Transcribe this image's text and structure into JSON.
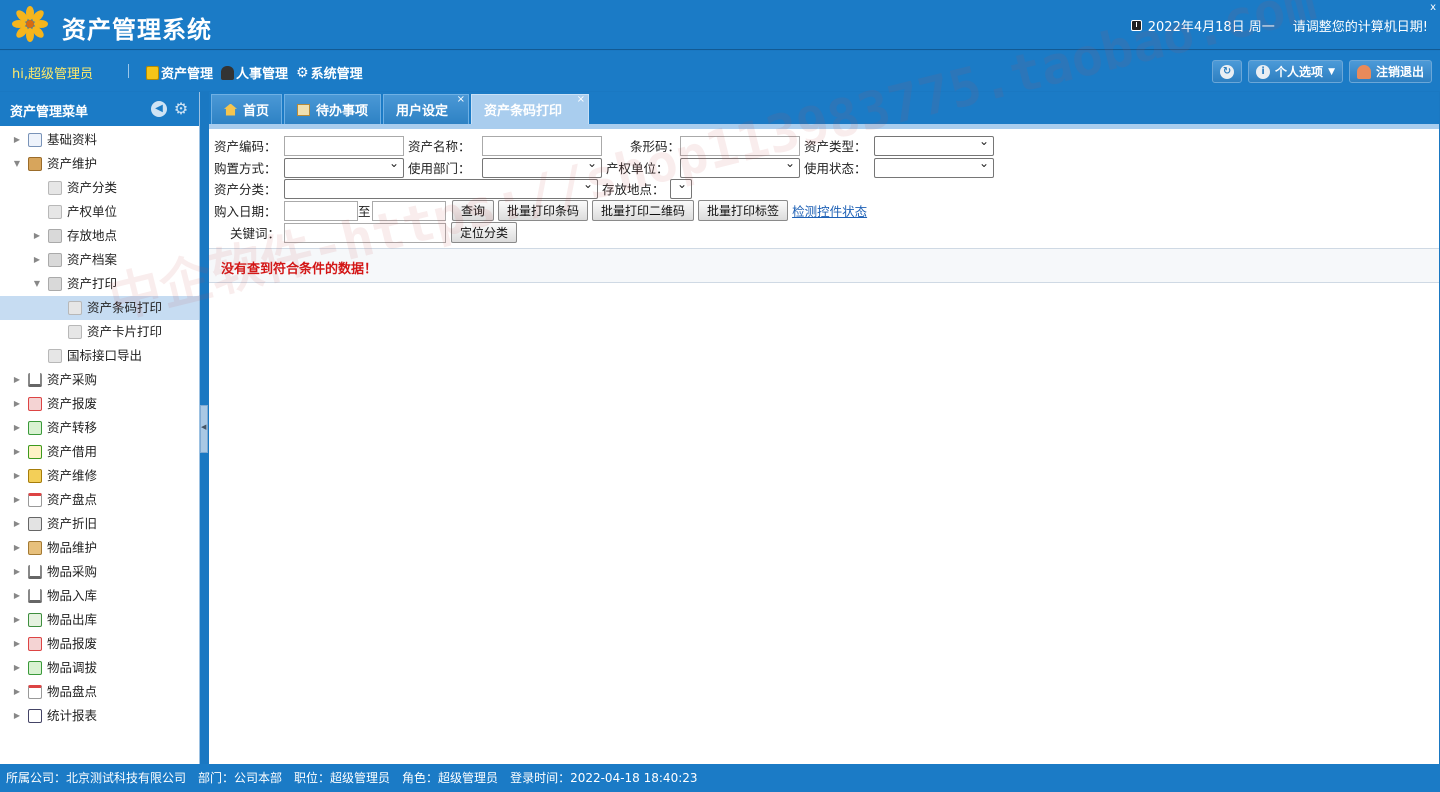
{
  "header": {
    "title": "资产管理系统",
    "date": "2022年4月18日 周一",
    "notice": "请调整您的计算机日期!",
    "close": "x"
  },
  "nav": {
    "greeting": "hi,超级管理员",
    "menus": [
      {
        "label": "资产管理",
        "icon": "book-icon"
      },
      {
        "label": "人事管理",
        "icon": "people-icon"
      },
      {
        "label": "系统管理",
        "icon": "gear-icon"
      }
    ],
    "personal": "个人选项",
    "logout": "注销退出"
  },
  "sidebar": {
    "title": "资产管理菜单",
    "items": [
      {
        "label": "基础资料",
        "depth": 0,
        "toggle": "collapsed",
        "icon": "image-icon"
      },
      {
        "label": "资产维护",
        "depth": 0,
        "toggle": "expanded",
        "icon": "box-icon"
      },
      {
        "label": "资产分类",
        "depth": 1,
        "toggle": "none",
        "icon": "file-icon"
      },
      {
        "label": "产权单位",
        "depth": 1,
        "toggle": "none",
        "icon": "file-icon"
      },
      {
        "label": "存放地点",
        "depth": 1,
        "toggle": "collapsed",
        "icon": "folder-icon"
      },
      {
        "label": "资产档案",
        "depth": 1,
        "toggle": "collapsed",
        "icon": "folder-icon"
      },
      {
        "label": "资产打印",
        "depth": 1,
        "toggle": "expanded",
        "icon": "folder-open-icon"
      },
      {
        "label": "资产条码打印",
        "depth": 2,
        "toggle": "none",
        "icon": "file-icon",
        "active": true
      },
      {
        "label": "资产卡片打印",
        "depth": 2,
        "toggle": "none",
        "icon": "file-icon"
      },
      {
        "label": "国标接口导出",
        "depth": 1,
        "toggle": "none",
        "icon": "file-icon"
      },
      {
        "label": "资产采购",
        "depth": 0,
        "toggle": "collapsed",
        "icon": "cart-icon"
      },
      {
        "label": "资产报废",
        "depth": 0,
        "toggle": "collapsed",
        "icon": "scrap-icon"
      },
      {
        "label": "资产转移",
        "depth": 0,
        "toggle": "collapsed",
        "icon": "transfer-icon"
      },
      {
        "label": "资产借用",
        "depth": 0,
        "toggle": "collapsed",
        "icon": "borrow-icon"
      },
      {
        "label": "资产维修",
        "depth": 0,
        "toggle": "collapsed",
        "icon": "repair-icon"
      },
      {
        "label": "资产盘点",
        "depth": 0,
        "toggle": "collapsed",
        "icon": "inventory-icon"
      },
      {
        "label": "资产折旧",
        "depth": 0,
        "toggle": "collapsed",
        "icon": "calculator-icon"
      },
      {
        "label": "物品维护",
        "depth": 0,
        "toggle": "collapsed",
        "icon": "mail-icon"
      },
      {
        "label": "物品采购",
        "depth": 0,
        "toggle": "collapsed",
        "icon": "cart-icon"
      },
      {
        "label": "物品入库",
        "depth": 0,
        "toggle": "collapsed",
        "icon": "stock-in-icon"
      },
      {
        "label": "物品出库",
        "depth": 0,
        "toggle": "collapsed",
        "icon": "stock-out-icon"
      },
      {
        "label": "物品报废",
        "depth": 0,
        "toggle": "collapsed",
        "icon": "scrap-icon"
      },
      {
        "label": "物品调拔",
        "depth": 0,
        "toggle": "collapsed",
        "icon": "transfer-icon"
      },
      {
        "label": "物品盘点",
        "depth": 0,
        "toggle": "collapsed",
        "icon": "inventory-icon"
      },
      {
        "label": "统计报表",
        "depth": 0,
        "toggle": "collapsed",
        "icon": "chart-icon"
      }
    ]
  },
  "tabs": [
    {
      "label": "首页",
      "icon": "home-icon",
      "closable": false,
      "selected": false
    },
    {
      "label": "待办事项",
      "icon": "todo-icon",
      "closable": false,
      "selected": false
    },
    {
      "label": "用户设定",
      "icon": "",
      "closable": true,
      "selected": false
    },
    {
      "label": "资产条码打印",
      "icon": "",
      "closable": true,
      "selected": true
    }
  ],
  "form": {
    "asset_code": "资产编码：",
    "asset_name": "资产名称：",
    "barcode": "条形码：",
    "asset_type": "资产类型：",
    "purchase_method": "购置方式：",
    "dept": "使用部门：",
    "owner_unit": "产权单位：",
    "use_status": "使用状态：",
    "asset_category": "资产分类：",
    "location": "存放地点：",
    "purchase_date": "购入日期：",
    "to": "至",
    "keyword": "关键词：",
    "btn_query": "查询",
    "btn_batch_barcode": "批量打印条码",
    "btn_batch_qr": "批量打印二维码",
    "btn_batch_label": "批量打印标签",
    "link_check": "检测控件状态",
    "btn_locate": "定位分类"
  },
  "message": "没有查到符合条件的数据！",
  "watermark": "中企软件-https://shop113983775.taobao.com",
  "footer": {
    "company": "所属公司：北京测试科技有限公司",
    "dept": "部门：公司本部",
    "position": "职位：超级管理员",
    "role": "角色：超级管理员",
    "login_time": "登录时间：2022-04-18 18:40:23"
  }
}
